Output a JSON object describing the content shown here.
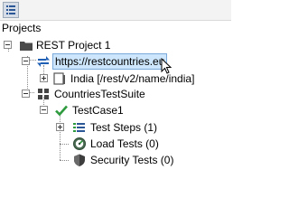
{
  "toolbar": {
    "icon": "list-view-icon"
  },
  "panel": {
    "title": "Projects"
  },
  "tree": {
    "project": {
      "label": "REST Project 1",
      "icon": "folder-icon",
      "expanded": true
    },
    "service": {
      "label": "https://restcountries.eu",
      "icon": "rest-service-icon",
      "selected": true,
      "expanded": true
    },
    "resource": {
      "label": "India [/rest/v2/name/india]",
      "icon": "resource-icon",
      "expanded": false
    },
    "suite": {
      "label": "CountriesTestSuite",
      "icon": "test-suite-icon",
      "expanded": true
    },
    "testcase": {
      "label": "TestCase1",
      "icon": "check-icon",
      "expanded": true
    },
    "children": [
      {
        "label": "Test Steps (1)",
        "icon": "test-steps-icon",
        "expandable": true
      },
      {
        "label": "Load Tests (0)",
        "icon": "load-tests-icon",
        "expandable": false
      },
      {
        "label": "Security Tests (0)",
        "icon": "security-tests-icon",
        "expandable": false
      }
    ]
  },
  "colors": {
    "selection_bg": "#cde6fb",
    "selection_border": "#7aa9dc",
    "check_green": "#2e9a3e",
    "arrow_blue": "#1f5fb4"
  }
}
